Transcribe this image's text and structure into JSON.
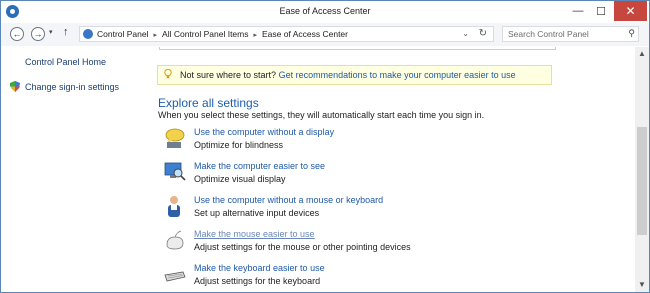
{
  "window": {
    "title": "Ease of Access Center"
  },
  "titlebar": {
    "minimize": "—",
    "maximize": "☐",
    "close": "✕"
  },
  "address": {
    "crumbs": [
      "Control Panel",
      "All Control Panel Items",
      "Ease of Access Center"
    ],
    "separator": "▸",
    "dropdown": "⌄",
    "refresh": "↻"
  },
  "nav": {
    "back": "←",
    "forward": "→",
    "recent": "▾",
    "up": "↑"
  },
  "search": {
    "placeholder": "Search Control Panel",
    "icon": "⚲"
  },
  "sidebar": {
    "home": "Control Panel Home",
    "signin": "Change sign-in settings"
  },
  "tip": {
    "static": "Not sure where to start?",
    "link": "Get recommendations to make your computer easier to use"
  },
  "explore": {
    "title": "Explore all settings",
    "description": "When you select these settings, they will automatically start each time you sign in."
  },
  "items": [
    {
      "link": "Use the computer without a display",
      "desc": "Optimize for blindness",
      "icon": "speech-bubble-icon"
    },
    {
      "link": "Make the computer easier to see",
      "desc": "Optimize visual display",
      "icon": "monitor-magnifier-icon"
    },
    {
      "link": "Use the computer without a mouse or keyboard",
      "desc": "Set up alternative input devices",
      "icon": "person-icon"
    },
    {
      "link": "Make the mouse easier to use",
      "desc": "Adjust settings for the mouse or other pointing devices",
      "icon": "mouse-icon"
    },
    {
      "link": "Make the keyboard easier to use",
      "desc": "Adjust settings for the keyboard",
      "icon": "keyboard-icon"
    }
  ],
  "scrollbar": {
    "up": "▲",
    "down": "▼"
  }
}
